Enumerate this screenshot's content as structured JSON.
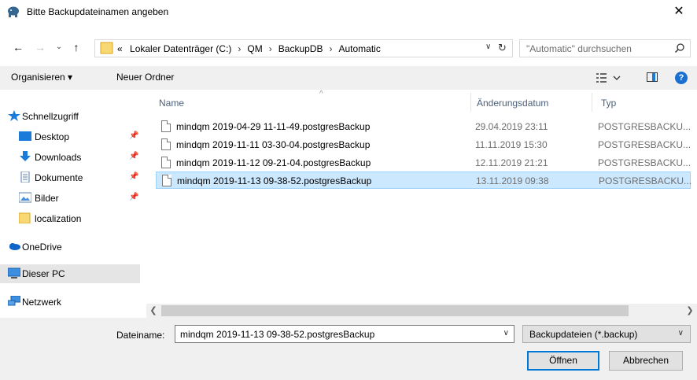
{
  "window": {
    "title": "Bitte Backupdateinamen angeben",
    "close_glyph": "✕"
  },
  "address": {
    "breadcrumb_prefix": "«",
    "crumbs": [
      "Lokaler Datenträger (C:)",
      "QM",
      "BackupDB",
      "Automatic"
    ],
    "search_placeholder": "\"Automatic\" durchsuchen"
  },
  "toolbar": {
    "organize_label": "Organisieren ▾",
    "new_folder_label": "Neuer Ordner"
  },
  "sidebar": {
    "items": [
      {
        "label": "Schnellzugriff",
        "icon": "star-icon"
      },
      {
        "label": "Desktop",
        "icon": "desktop-icon",
        "pinned": true
      },
      {
        "label": "Downloads",
        "icon": "download-arrow-icon",
        "pinned": true
      },
      {
        "label": "Dokumente",
        "icon": "document-icon",
        "pinned": true
      },
      {
        "label": "Bilder",
        "icon": "pictures-icon",
        "pinned": true
      },
      {
        "label": "localization",
        "icon": "folder-icon"
      },
      {
        "label": "OneDrive",
        "icon": "cloud-icon"
      },
      {
        "label": "Dieser PC",
        "icon": "monitor-icon",
        "selected": true
      },
      {
        "label": "Netzwerk",
        "icon": "network-icon"
      }
    ]
  },
  "filelist": {
    "columns": {
      "name": "Name",
      "date": "Änderungsdatum",
      "type": "Typ"
    },
    "rows": [
      {
        "name": "mindqm 2019-04-29 11-11-49.postgresBackup",
        "date": "29.04.2019 23:11",
        "type": "POSTGRESBACKU..."
      },
      {
        "name": "mindqm 2019-11-11 03-30-04.postgresBackup",
        "date": "11.11.2019 15:30",
        "type": "POSTGRESBACKU..."
      },
      {
        "name": "mindqm 2019-11-12 09-21-04.postgresBackup",
        "date": "12.11.2019 21:21",
        "type": "POSTGRESBACKU..."
      },
      {
        "name": "mindqm 2019-11-13 09-38-52.postgresBackup",
        "date": "13.11.2019 09:38",
        "type": "POSTGRESBACKU...",
        "selected": true
      }
    ]
  },
  "footer": {
    "filename_label": "Dateiname:",
    "filename_value": "mindqm 2019-11-13 09-38-52.postgresBackup",
    "filetype_value": "Backupdateien (*.backup)",
    "open_label": "Öffnen",
    "cancel_label": "Abbrechen"
  },
  "colors": {
    "selection_bg": "#cce8ff",
    "selection_border": "#99d1ff",
    "accent": "#0078d7"
  }
}
